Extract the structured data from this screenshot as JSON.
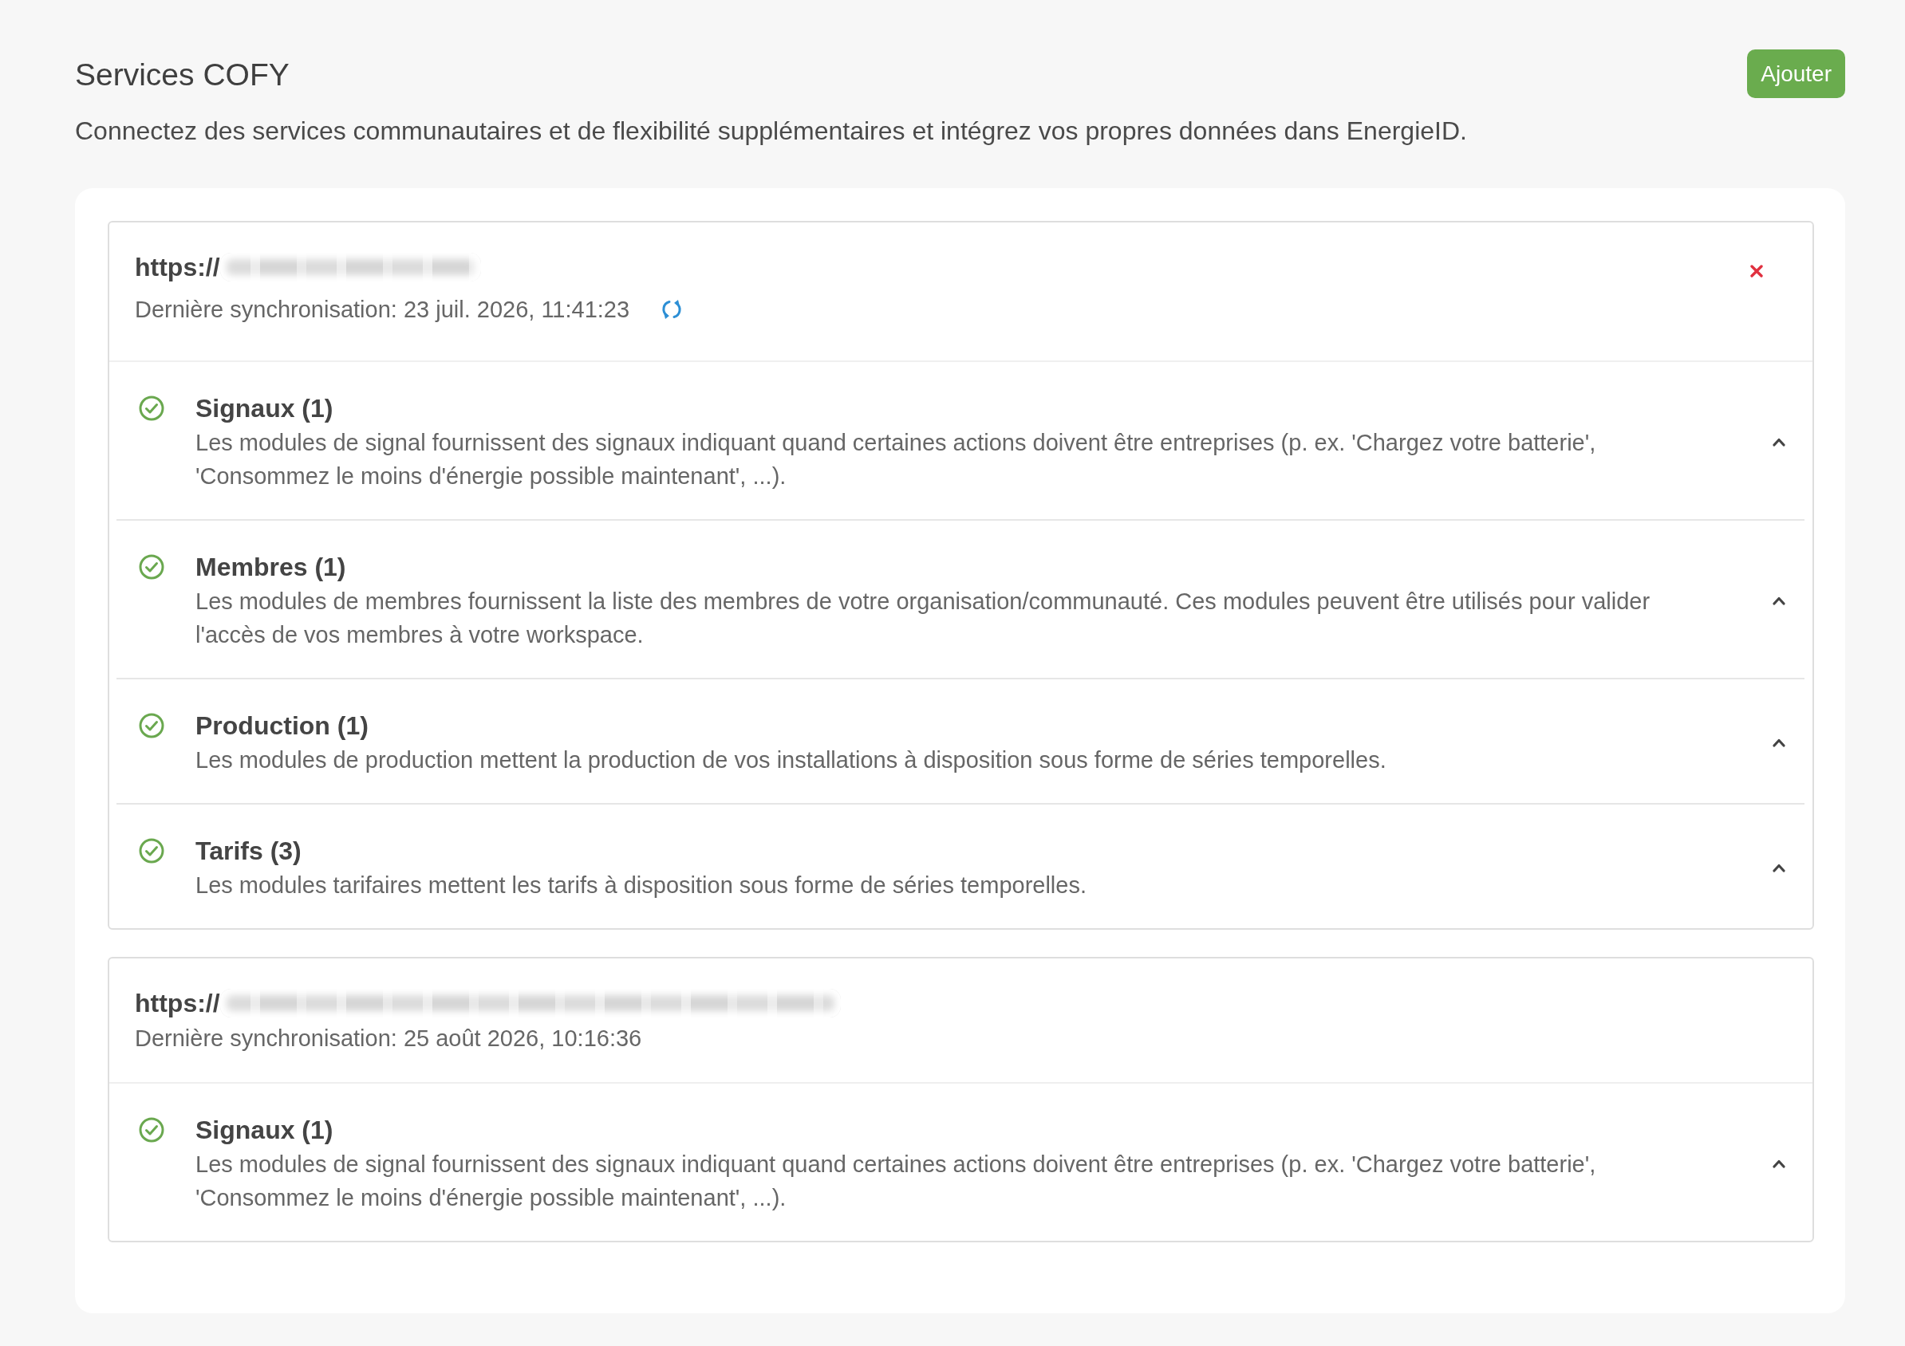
{
  "page": {
    "title": "Services COFY",
    "add_button": "Ajouter",
    "description": "Connectez des services communautaires et de flexibilité supplémentaires et intégrez vos propres données dans EnergieID."
  },
  "sources": [
    {
      "url_prefix": "https://",
      "url_blurred": true,
      "last_sync": "Dernière synchronisation: 23 juil. 2026, 11:41:23",
      "sync_button": true,
      "remove_button": true,
      "modules": [
        {
          "title": "Signaux (1)",
          "description": "Les modules de signal fournissent des signaux indiquant quand certaines actions doivent être entreprises (p. ex. 'Chargez votre batterie', 'Consommez le moins d'énergie possible maintenant', ...).",
          "active": true,
          "expanded": true
        },
        {
          "title": "Membres (1)",
          "description": "Les modules de membres fournissent la liste des membres de votre organisation/communauté. Ces modules peuvent être utilisés pour valider l'accès de vos membres à votre workspace.",
          "active": true,
          "expanded": true
        },
        {
          "title": "Production (1)",
          "description": "Les modules de production mettent la production de vos installations à disposition sous forme de séries temporelles.",
          "active": true,
          "expanded": true
        },
        {
          "title": "Tarifs (3)",
          "description": "Les modules tarifaires mettent les tarifs à disposition sous forme de séries temporelles.",
          "active": true,
          "expanded": true
        }
      ]
    },
    {
      "url_prefix": "https://",
      "url_blurred": true,
      "last_sync": "Dernière synchronisation: 25 août 2026, 10:16:36",
      "sync_button": false,
      "remove_button": false,
      "modules": [
        {
          "title": "Signaux (1)",
          "description": "Les modules de signal fournissent des signaux indiquant quand certaines actions doivent être entreprises (p. ex. 'Chargez votre batterie', 'Consommez le moins d'énergie possible maintenant', ...).",
          "active": true,
          "expanded": true
        }
      ]
    }
  ]
}
